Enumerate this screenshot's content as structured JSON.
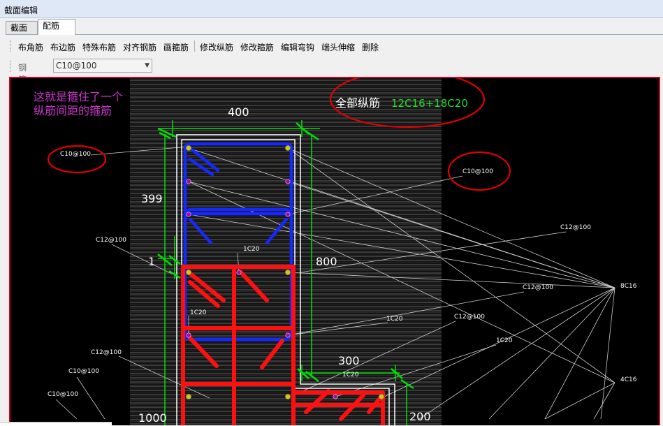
{
  "window": {
    "title": "截面编辑"
  },
  "tabs": [
    {
      "label": "截面",
      "active": false
    },
    {
      "label": "配筋",
      "active": true
    }
  ],
  "toolbar": {
    "items": [
      "布角筋",
      "布边筋",
      "特殊布筋",
      "对齐钢筋",
      "画箍筋",
      "修改纵筋",
      "修改箍筋",
      "编辑弯钩",
      "端头伸缩",
      "删除"
    ]
  },
  "rebar_info": {
    "label": "钢筋信息",
    "value": "C10@100"
  },
  "canvas": {
    "annotation_line1": "这就是箍住了一个",
    "annotation_line2": "纵筋间距的箍筋",
    "all_rebar_label": "全部纵筋",
    "all_rebar_value": "12C16+18C20",
    "dim_top": "400",
    "dim_left": "399",
    "dim_small": "1",
    "dim_right": "800",
    "dim_step": "300",
    "dim_bottom_left": "1000",
    "dim_bottom_right": "200",
    "labels": {
      "c10_left": "C10@100",
      "c10_right": "C10@100",
      "c12_left": "C12@100",
      "c12_r1": "C12@100",
      "c12_r2": "C12@100",
      "c12_r3": "C12@100",
      "c12_bl": "C12@100",
      "c10_bl1": "C10@100",
      "c10_bl2": "C10@100",
      "b1c20_a": "1C20",
      "b1c20_b": "1C20",
      "b1c20_c": "1C20",
      "b1c20_d": "1C20",
      "b1c20_e": "1C20",
      "b8c16": "8C16",
      "b4c16": "4C16"
    },
    "colors": {
      "annotation": "#cc33cc",
      "dimension": "#00e000",
      "stirrup_blue": "#1428ff",
      "stirrup_red": "#ff1010",
      "highlight_ellipse": "#e00000"
    }
  }
}
